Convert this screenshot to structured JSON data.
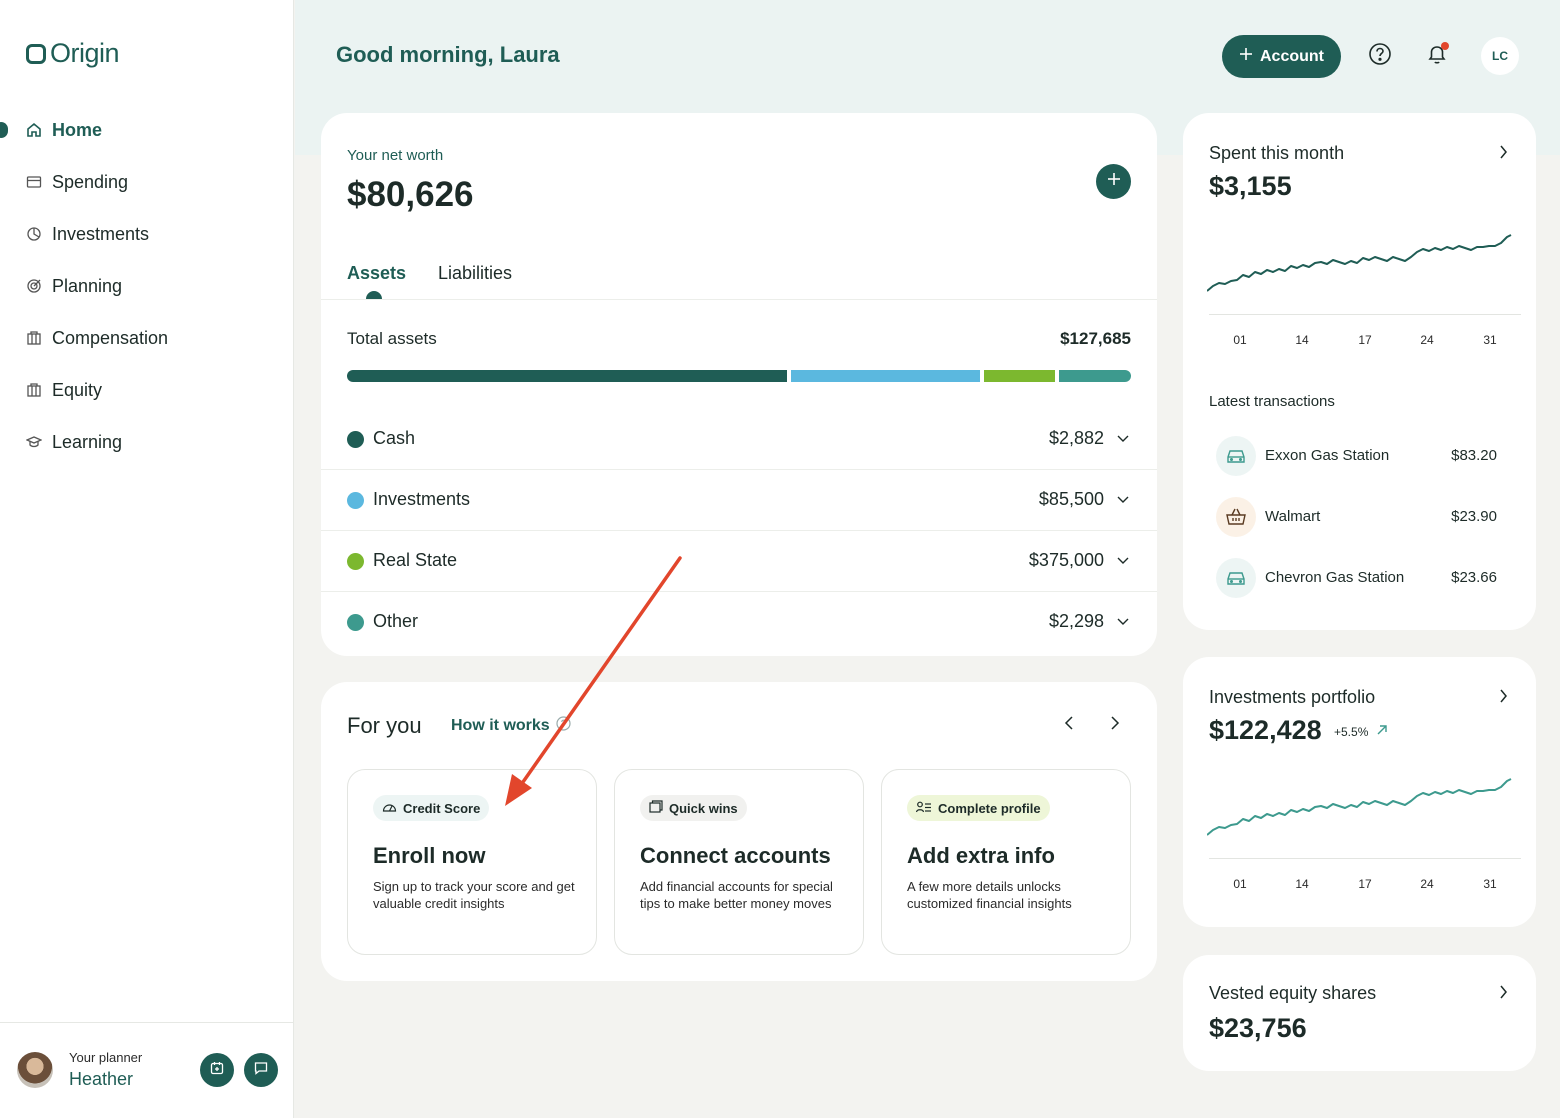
{
  "sidebar": {
    "logo_text": "Origin",
    "items": [
      {
        "label": "Home",
        "icon": "home-icon",
        "active": true
      },
      {
        "label": "Spending",
        "icon": "card-icon"
      },
      {
        "label": "Investments",
        "icon": "pie-chart-icon"
      },
      {
        "label": "Planning",
        "icon": "target-icon"
      },
      {
        "label": "Compensation",
        "icon": "building-icon"
      },
      {
        "label": "Equity",
        "icon": "building-icon"
      },
      {
        "label": "Learning",
        "icon": "graduation-cap-icon"
      }
    ],
    "planner": {
      "label": "Your planner",
      "name": "Heather"
    }
  },
  "header": {
    "greeting": "Good morning, Laura",
    "account_button": "Account",
    "user_initials": "LC"
  },
  "net_worth": {
    "label": "Your net worth",
    "value": "$80,626",
    "tabs": [
      "Assets",
      "Liabilities"
    ],
    "total_label": "Total assets",
    "total_value": "$127,685",
    "assets": [
      {
        "name": "Cash",
        "value": "$2,882",
        "color": "#1f5d55"
      },
      {
        "name": "Investments",
        "value": "$85,500",
        "color": "#5bb8df"
      },
      {
        "name": "Real State",
        "value": "$375,000",
        "color": "#7cb82f"
      },
      {
        "name": "Other",
        "value": "$2,298",
        "color": "#3d9a8e"
      }
    ]
  },
  "for_you": {
    "title": "For you",
    "how_it_works": "How it works",
    "tiles": [
      {
        "chip": "Credit Score",
        "title": "Enroll now",
        "desc": "Sign up to track your score and get valuable credit insights",
        "chip_color": "#edf5f4"
      },
      {
        "chip": "Quick wins",
        "title": "Connect accounts",
        "desc": "Add financial accounts for special tips to make better money moves",
        "chip_color": "#f1f1ef"
      },
      {
        "chip": "Complete profile",
        "title": "Add extra info",
        "desc": "A few more details unlocks customized financial insights",
        "chip_color": "#eef6d8"
      }
    ]
  },
  "spent": {
    "title": "Spent this month",
    "value": "$3,155",
    "ticks": [
      "01",
      "14",
      "17",
      "24",
      "31"
    ],
    "latest_label": "Latest transactions",
    "transactions": [
      {
        "name": "Exxon Gas Station",
        "amount": "$83.20",
        "icon": "car-icon"
      },
      {
        "name": "Walmart",
        "amount": "$23.90",
        "icon": "shopping-basket-icon"
      },
      {
        "name": "Chevron Gas Station",
        "amount": "$23.66",
        "icon": "car-icon"
      }
    ]
  },
  "portfolio": {
    "title": "Investments portfolio",
    "value": "$122,428",
    "change": "+5.5%",
    "ticks": [
      "01",
      "14",
      "17",
      "24",
      "31"
    ]
  },
  "equity": {
    "title": "Vested equity shares",
    "value": "$23,756"
  },
  "colors": {
    "brand": "#1f5d55",
    "accent_red": "#e2462c"
  }
}
